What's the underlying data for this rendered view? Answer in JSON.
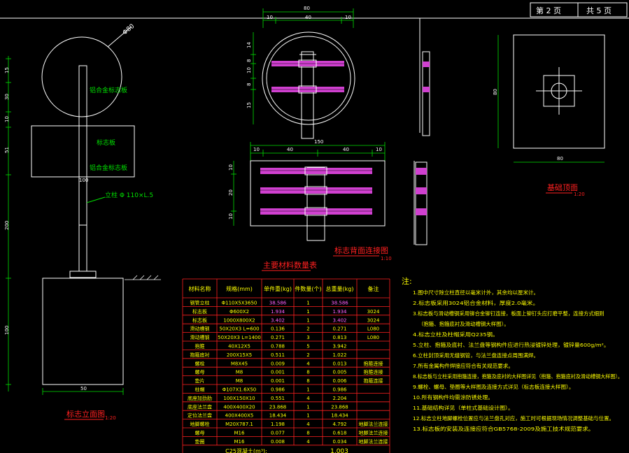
{
  "title_block": {
    "sheet_label": "第 2 页",
    "total_label": "共 5 页"
  },
  "front_view": {
    "dims_left": [
      "15",
      "30",
      "10",
      "51",
      "200",
      "100"
    ],
    "dim_diameter": "Φ80",
    "circle_label": "铝合金标志板",
    "rect_label_1": "标志板",
    "rect_label_2": "铝合金标志板",
    "pole_dim": "100",
    "pole_label": "立柱 Φ 110×L.5",
    "bottom_dim": "50",
    "title": "标志立面图",
    "scale": "1:20"
  },
  "back_view": {
    "top_dims": [
      "80",
      "10",
      "40",
      "10"
    ],
    "left_dims": [
      "14",
      "8",
      "10",
      "8",
      "15"
    ],
    "mid_dims": [
      "150",
      "10",
      "40",
      "40",
      "10"
    ],
    "side_dims": [
      "10",
      "20",
      "10"
    ],
    "title": "标志背面连接图",
    "scale": "1:10"
  },
  "foundation_plan": {
    "dim_side": "80",
    "dim_bottom": "80",
    "title": "基础顶面",
    "scale": "1:20"
  },
  "material_table": {
    "title": "主要材料数量表",
    "headers": [
      "材料名称",
      "规格(mm)",
      "单件重(kg)",
      "件数量(个)",
      "总重量(kg)",
      "备注"
    ],
    "rows": [
      [
        "钢管立柱",
        "Φ110X5X3650",
        "38.586",
        "1",
        "38.586",
        ""
      ],
      [
        "标志板",
        "Φ600X2",
        "1.934",
        "1",
        "1.934",
        "3024"
      ],
      [
        "标志板",
        "1000X800X2",
        "3.402",
        "1",
        "3.402",
        "3024"
      ],
      [
        "滑动槽钢",
        "50X20X3 L=600",
        "0.136",
        "2",
        "0.271",
        "L080"
      ],
      [
        "滑动槽钢",
        "50X20X3 L=1400",
        "0.271",
        "3",
        "0.813",
        "L080"
      ],
      [
        "抱箍",
        "40X12X5",
        "0.788",
        "5",
        "3.942",
        ""
      ],
      [
        "抱箍底衬",
        "200X15X5",
        "0.511",
        "2",
        "1.022",
        ""
      ],
      [
        "螺栓",
        "M8X45",
        "0.009",
        "4",
        "0.013",
        "抱箍连接"
      ],
      [
        "螺母",
        "M8",
        "0.001",
        "8",
        "0.005",
        "抱箍连接"
      ],
      [
        "垫片",
        "M8",
        "0.001",
        "8",
        "0.006",
        "抱箍连接"
      ],
      [
        "柱帽",
        "Φ107X1.6X50",
        "0.986",
        "1",
        "0.986",
        ""
      ],
      [
        "底座加劲肋",
        "100X150X10",
        "0.551",
        "4",
        "2.204",
        ""
      ],
      [
        "底座法兰盘",
        "400X400X20",
        "23.868",
        "1",
        "23.868",
        ""
      ],
      [
        "定位法兰盘",
        "400X400X5",
        "18.434",
        "1",
        "18.434",
        ""
      ],
      [
        "地脚螺栓",
        "M20X787.1",
        "1.198",
        "4",
        "4.792",
        "地脚法兰连接"
      ],
      [
        "螺母",
        "M16",
        "0.077",
        "8",
        "0.618",
        "地脚法兰连接"
      ],
      [
        "垫圈",
        "M16",
        "0.008",
        "4",
        "0.034",
        "地脚法兰连接"
      ]
    ],
    "footer_label": "C25混凝土(m³):",
    "footer_value": "1.003"
  },
  "notes": {
    "heading": "注:",
    "items": [
      "1.图中尺寸除立柱直径以毫米计外，其余均以厘米计。",
      "2.标志板采用3024铝合金材料，厚度2.0毫米。",
      "3.标志板与滑动槽钢采用铆合金铆钉连接，板面上铆钉头应打磨平整，连接方式细则",
      "（抱箍、抱箍底衬及滑动槽钢大样图）。",
      "4.标志立柱及柱帽采用Q235钢。",
      "5.立柱、抱箍及底衬、法兰盘等钢构件应进行热浸镀锌处理，镀锌量600g/m²。",
      "6.立柱封顶采用无缝钢管，与法兰盘连接点周围满焊。",
      "7.所有金属构件焊接应符合有关规范要求。",
      "8.标志板与立柱采用抱箍连接，抱箍及底衬的大样图详见（抱箍、抱箍底衬及滑动槽钢大样图）。",
      "9.螺栓、螺母、垫圈等大样图及连接方式详见（标志板连接大样图）。",
      "10.所有钢构件均需涂防锈处理。",
      "11.基础结构详见（单柱式基础设计图）。",
      "12.标志立柱地脚螺栓位置应与法兰盘孔对应，施工时可根据现场情况调整基础与位置。",
      "13.标志板的安装及连接应符合GB5768-2009及施工技术规范要求。"
    ]
  },
  "colors": {
    "line": "#ffffff",
    "dim": "#00e000",
    "label": "#00e000",
    "accent": "#ff2020",
    "panel": "#d040d0",
    "table_text": "#ffff00",
    "notes": "#00ffff"
  }
}
